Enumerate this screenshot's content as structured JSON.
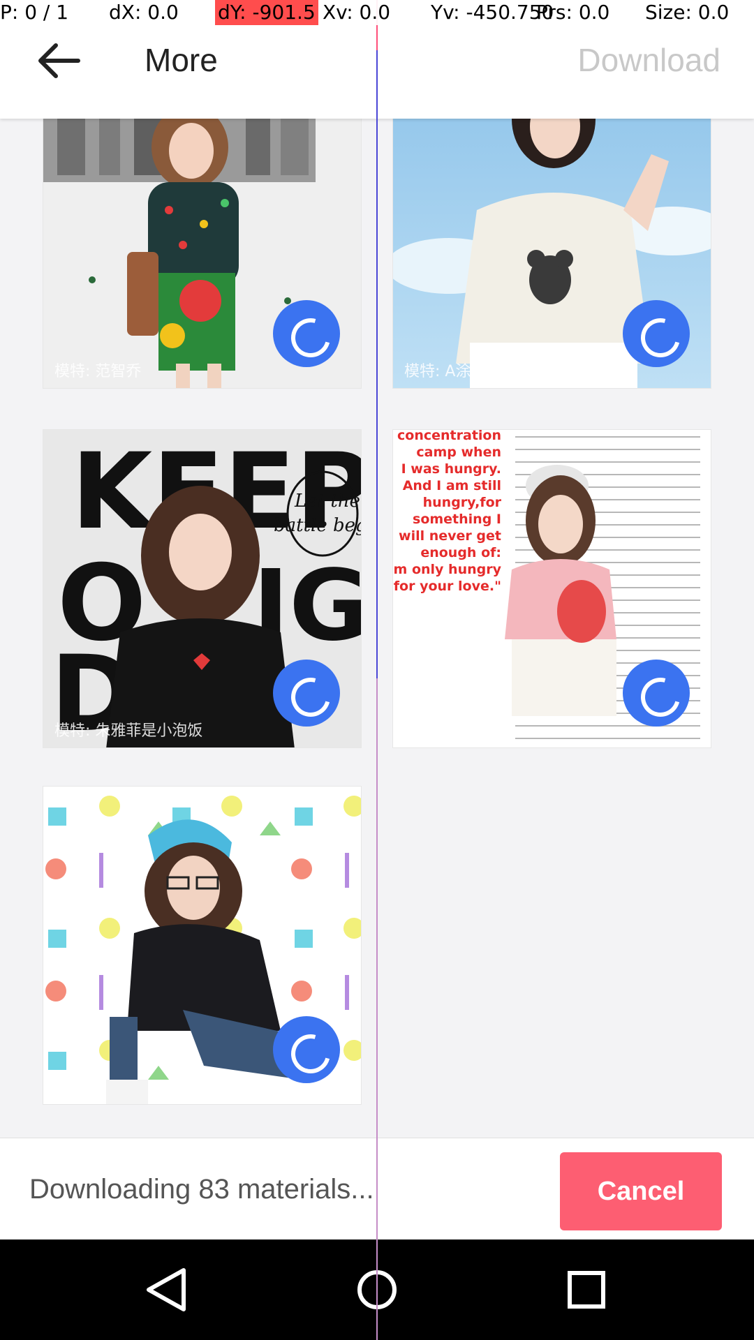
{
  "debug": {
    "p": "P: 0 / 1",
    "dx": "dX: 0.0",
    "dy": "dY: -901.5",
    "xv": "Xv: 0.0",
    "yv": "Yv: -450.750",
    "prs": "Prs: 0.0",
    "size": "Size: 0.0"
  },
  "header": {
    "back_icon": "arrow-left-icon",
    "title": "More",
    "download_label": "Download"
  },
  "materials": [
    {
      "watermark": "模特: 范智乔",
      "status_icon": "loading-spinner-icon"
    },
    {
      "watermark": "模特: A涂",
      "status_icon": "loading-spinner-icon"
    },
    {
      "watermark": "模特: 朱雅菲是小泡饭",
      "status_icon": "loading-spinner-icon",
      "poster_text": [
        "KEEP",
        "O",
        "IG",
        "DA"
      ],
      "script_text": [
        "Let the",
        "battle begin"
      ]
    },
    {
      "watermark": "",
      "status_icon": "loading-spinner-icon",
      "quote_lines": [
        "concentration",
        "camp when",
        "I was hungry.",
        "And I am still",
        "hungry,for",
        "something I",
        "will never get",
        "enough of:",
        "I am only hungry",
        "for your love.\""
      ]
    },
    {
      "watermark": "",
      "status_icon": "loading-spinner-icon"
    }
  ],
  "footer": {
    "status_text": "Downloading 83 materials...",
    "cancel_label": "Cancel"
  },
  "system_nav": {
    "back_icon": "nav-back-triangle-icon",
    "home_icon": "nav-home-circle-icon",
    "recents_icon": "nav-recents-square-icon"
  },
  "colors": {
    "accent_blue": "#3b73f0",
    "cancel_red": "#fd5e72",
    "debug_highlight": "#ff4d4d"
  }
}
